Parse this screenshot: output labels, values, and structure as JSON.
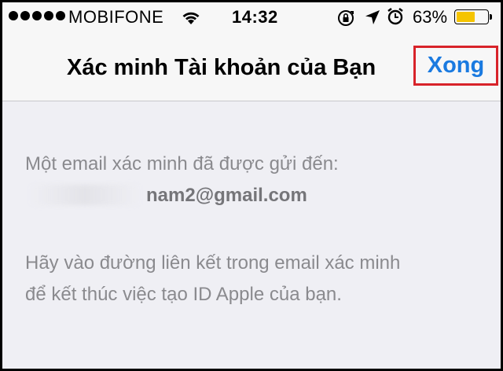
{
  "status_bar": {
    "carrier": "MOBIFONE",
    "time": "14:32",
    "battery_percent": "63%",
    "battery_level": 0.63,
    "battery_color": "#f5c400",
    "icons": [
      "signal-dots-icon",
      "wifi-icon",
      "rotation-lock-icon",
      "location-arrow-icon",
      "alarm-icon",
      "battery-icon"
    ]
  },
  "nav": {
    "title": "Xác minh Tài khoản của Bạn",
    "done_label": "Xong",
    "done_color": "#1a7ae0",
    "highlight_color": "#d8232a"
  },
  "message": {
    "line1": "Một email xác minh đã được gửi đến:",
    "email": "nam2@gmail.com",
    "line3": "Hãy vào đường liên kết trong email xác minh",
    "line4": "để kết thúc việc tạo ID Apple của bạn."
  }
}
